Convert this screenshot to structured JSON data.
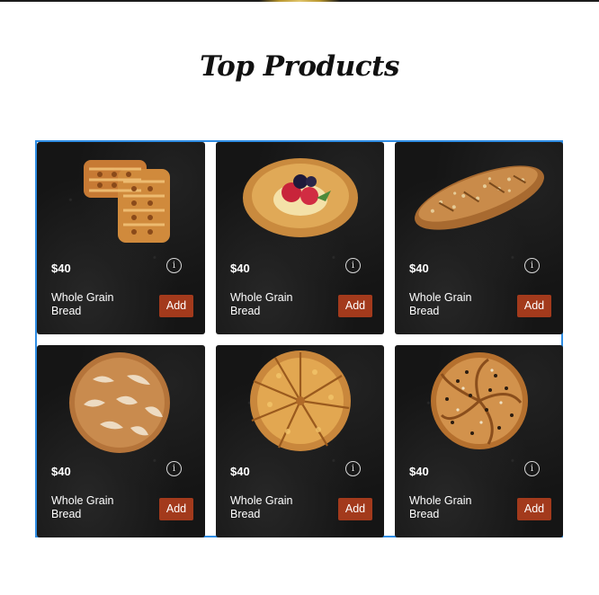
{
  "page": {
    "title": "Top Products"
  },
  "products": [
    {
      "price": "$40",
      "name": "Whole Grain Bread",
      "add_label": "Add",
      "info_label": "i",
      "image": "lattice-pastry"
    },
    {
      "price": "$40",
      "name": "Whole Grain Bread",
      "add_label": "Add",
      "info_label": "i",
      "image": "berry-danish"
    },
    {
      "price": "$40",
      "name": "Whole Grain Bread",
      "add_label": "Add",
      "info_label": "i",
      "image": "seeded-baguette"
    },
    {
      "price": "$40",
      "name": "Whole Grain Bread",
      "add_label": "Add",
      "info_label": "i",
      "image": "sourdough-boule"
    },
    {
      "price": "$40",
      "name": "Whole Grain Bread",
      "add_label": "Add",
      "info_label": "i",
      "image": "sliced-pie"
    },
    {
      "price": "$40",
      "name": "Whole Grain Bread",
      "add_label": "Add",
      "info_label": "i",
      "image": "seeded-kaiser-roll"
    }
  ],
  "colors": {
    "card_background": "#151515",
    "add_button": "#a33a1c",
    "selection_outline": "#2f8de4"
  }
}
